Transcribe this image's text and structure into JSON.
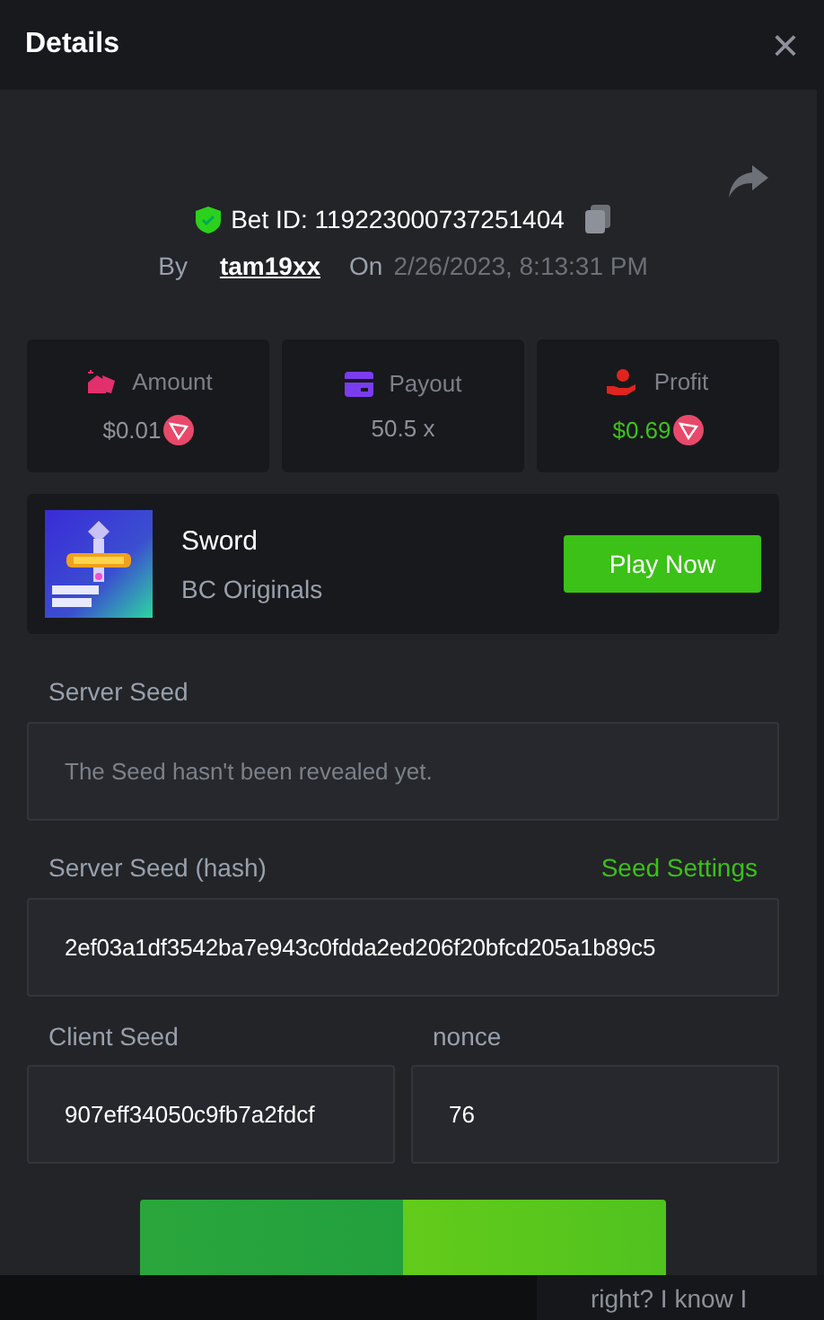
{
  "header": {
    "title": "Details",
    "close": "×"
  },
  "bet": {
    "verified": true,
    "id_label": "Bet ID: 119223000737251404",
    "by_label": "By",
    "user": "tam19xx",
    "on_label": "On",
    "date": "2/26/2023, 8:13:31 PM"
  },
  "stats": [
    {
      "kind": "amount",
      "label": "Amount",
      "value": "$0.01",
      "coin": true,
      "color": "#e1306c"
    },
    {
      "kind": "payout",
      "label": "Payout",
      "value": "50.5 x",
      "coin": false,
      "color": "#7b3cf0"
    },
    {
      "kind": "profit",
      "label": "Profit",
      "value": "$0.69",
      "coin": true,
      "color": "#e0241f"
    }
  ],
  "game": {
    "name": "Sword",
    "provider": "BC Originals",
    "button": "Play Now"
  },
  "server_seed": {
    "label": "Server Seed",
    "placeholder": "The Seed hasn't been revealed yet."
  },
  "server_seed_hash": {
    "label": "Server Seed (hash)",
    "link": "Seed Settings",
    "value": "2ef03a1df3542ba7e943c0fdda2ed206f20bfcd205a1b89c5"
  },
  "client_seed": {
    "label": "Client Seed",
    "value": "907eff34050c9fb7a2fdcf"
  },
  "nonce": {
    "label": "nonce",
    "value": "76"
  },
  "bottom_bar": {
    "chat_text": "right? I know I"
  }
}
